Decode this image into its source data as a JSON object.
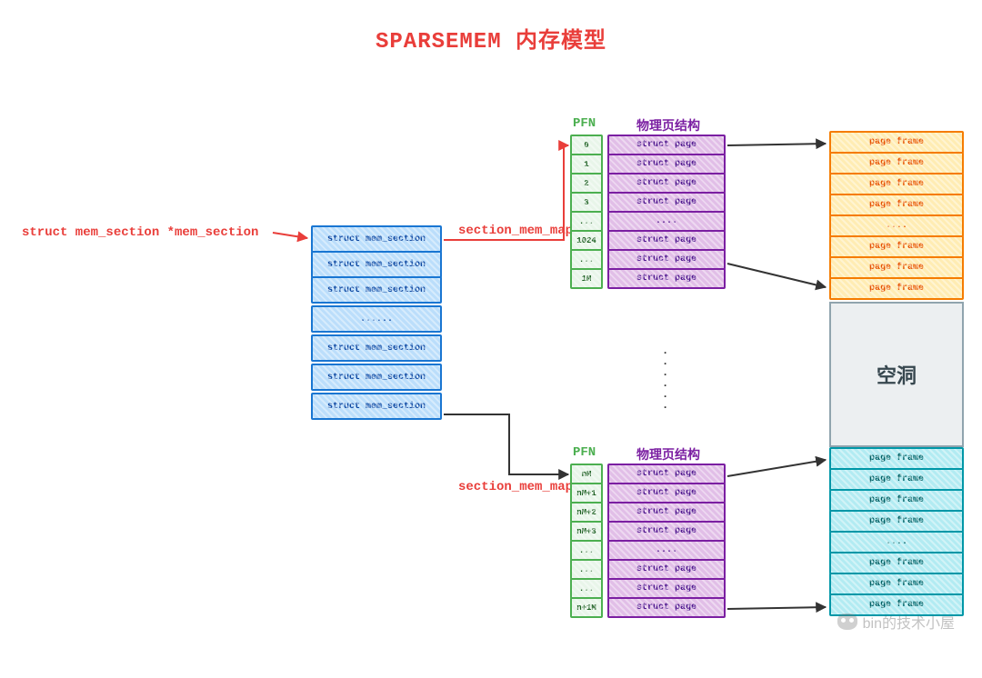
{
  "title": "SPARSEMEM 内存模型",
  "labels": {
    "pointer": "struct mem_section *mem_section",
    "section_map_top": "section_mem_map",
    "section_map_bottom": "section_mem_map",
    "pfn": "PFN",
    "phys_page_struct": "物理页结构",
    "gap": "空洞"
  },
  "mem_section_cells": [
    "struct mem_section",
    "struct mem_section",
    "struct mem_section",
    "......",
    "struct mem_section",
    "struct mem_section",
    "struct mem_section"
  ],
  "top_group": {
    "pfn": [
      "0",
      "1",
      "2",
      "3",
      "...",
      "1024",
      "...",
      "1M"
    ],
    "pages": [
      "struct page",
      "struct page",
      "struct page",
      "struct page",
      "....",
      "struct page",
      "struct page",
      "struct page"
    ],
    "frames": [
      "page frame",
      "page frame",
      "page frame",
      "page frame",
      "....",
      "page frame",
      "page frame",
      "page frame"
    ]
  },
  "bottom_group": {
    "pfn": [
      "nM",
      "nM+1",
      "nM+2",
      "nM+3",
      "...",
      "...",
      "...",
      "n+1M"
    ],
    "pages": [
      "struct page",
      "struct page",
      "struct page",
      "struct page",
      "....",
      "struct page",
      "struct page",
      "struct page"
    ],
    "frames": [
      "page frame",
      "page frame",
      "page frame",
      "page frame",
      "....",
      "page frame",
      "page frame",
      "page frame"
    ]
  },
  "watermark": "bin的技术小屋"
}
